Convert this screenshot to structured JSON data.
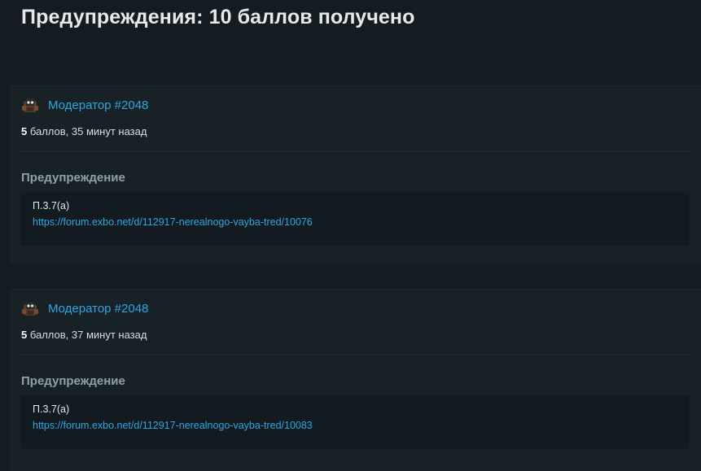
{
  "page": {
    "title": "Предупреждения: 10 баллов получено"
  },
  "warnings": [
    {
      "moderator": "Модератор #2048",
      "points": "5",
      "points_suffix": " баллов, 35 минут назад",
      "section_heading": "Предупреждение",
      "reason": "П.3.7(а)",
      "link": "https://forum.exbo.net/d/112917-nerealnogo-vayba-tred/10076"
    },
    {
      "moderator": "Модератор #2048",
      "points": "5",
      "points_suffix": " баллов, 37 минут назад",
      "section_heading": "Предупреждение",
      "reason": "П.3.7(а)",
      "link": "https://forum.exbo.net/d/112917-nerealnogo-vayba-tred/10083"
    }
  ],
  "colors": {
    "background": "#141c22",
    "card": "#182126",
    "link": "#2ea7e0",
    "heading_muted": "#8fa0aa"
  },
  "icons": {
    "avatar": "moderator-avatar-icon"
  }
}
